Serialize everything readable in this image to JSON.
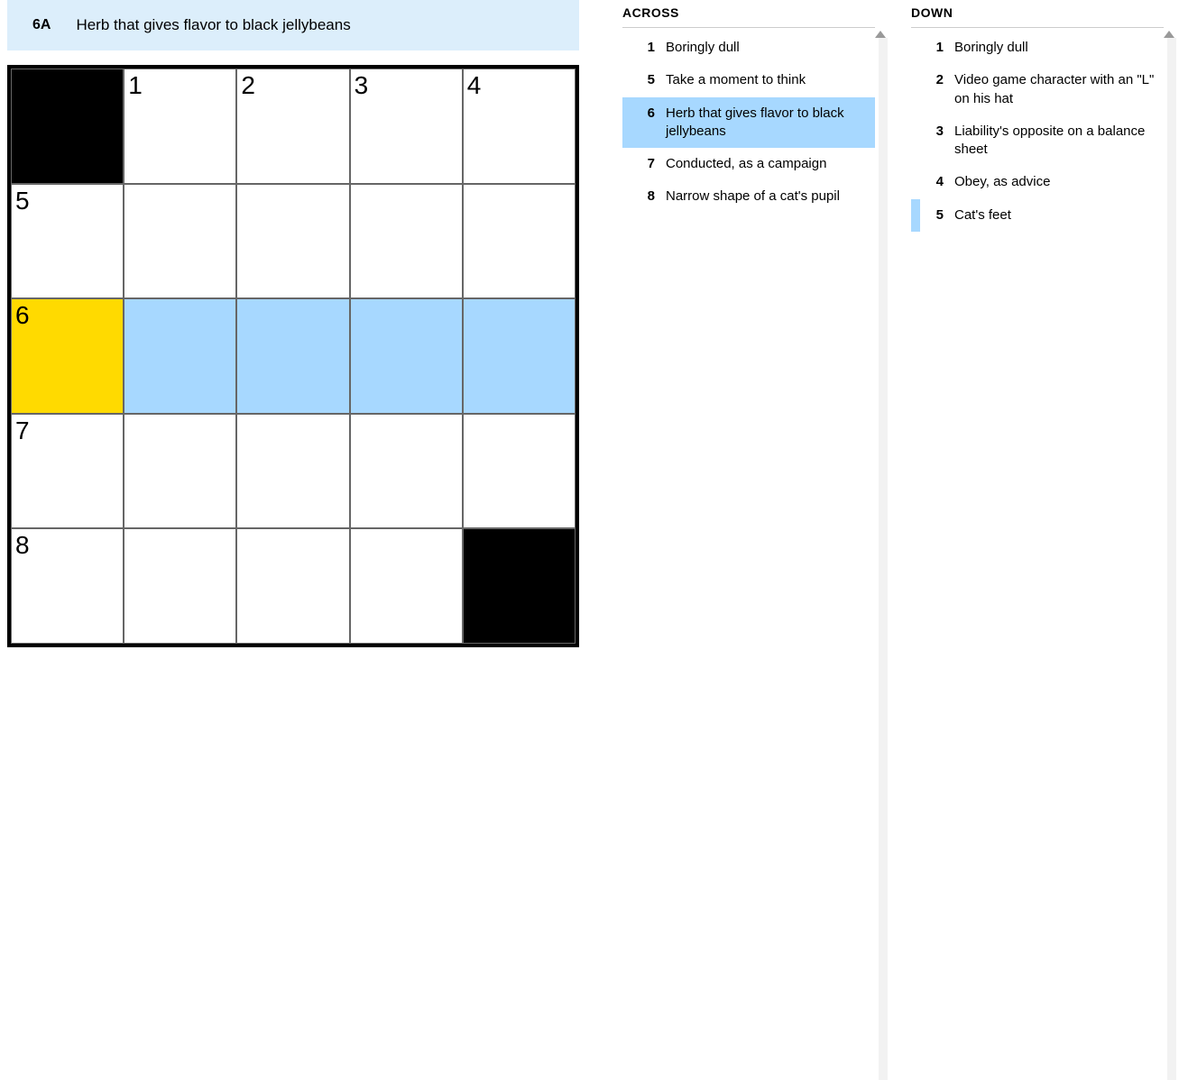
{
  "current_clue": {
    "label": "6A",
    "text": "Herb that gives flavor to black jellybeans"
  },
  "grid": {
    "rows": 5,
    "cols": 5,
    "cells": [
      [
        {
          "black": true
        },
        {
          "num": "1"
        },
        {
          "num": "2"
        },
        {
          "num": "3"
        },
        {
          "num": "4"
        }
      ],
      [
        {
          "num": "5"
        },
        {},
        {},
        {},
        {}
      ],
      [
        {
          "num": "6",
          "cursor": true
        },
        {
          "hl": true
        },
        {
          "hl": true
        },
        {
          "hl": true
        },
        {
          "hl": true
        }
      ],
      [
        {
          "num": "7"
        },
        {},
        {},
        {},
        {}
      ],
      [
        {
          "num": "8"
        },
        {},
        {},
        {},
        {
          "black": true
        }
      ]
    ]
  },
  "across": {
    "title": "ACROSS",
    "clues": [
      {
        "num": "1",
        "text": "Boringly dull"
      },
      {
        "num": "5",
        "text": "Take a moment to think"
      },
      {
        "num": "6",
        "text": "Herb that gives flavor to black jellybeans",
        "selected": true
      },
      {
        "num": "7",
        "text": "Conducted, as a campaign"
      },
      {
        "num": "8",
        "text": "Narrow shape of a cat's pupil"
      }
    ]
  },
  "down": {
    "title": "DOWN",
    "clues": [
      {
        "num": "1",
        "text": "Boringly dull"
      },
      {
        "num": "2",
        "text": "Video game character with an \"L\" on his hat"
      },
      {
        "num": "3",
        "text": "Liability's opposite on a balance sheet"
      },
      {
        "num": "4",
        "text": "Obey, as advice"
      },
      {
        "num": "5",
        "text": "Cat's feet",
        "related": true
      }
    ]
  }
}
